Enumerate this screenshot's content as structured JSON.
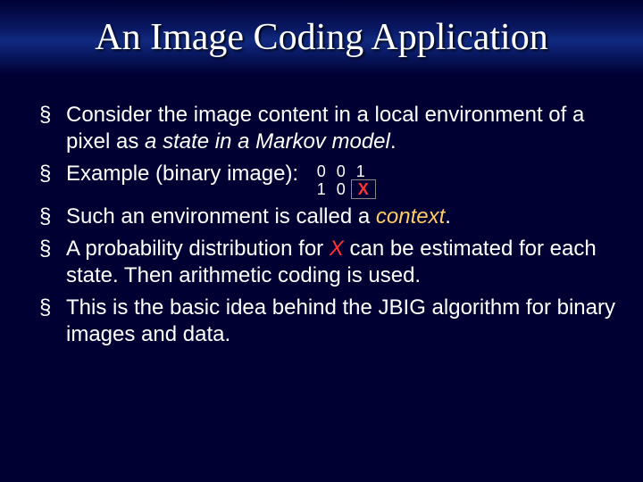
{
  "title": "An Image Coding Application",
  "bullets1": {
    "b1_a": "Consider the image content in a local environment of a pixel as ",
    "b1_b": "a state in a Markov model",
    "b1_c": ".",
    "b2_a": "Example (binary image):"
  },
  "grid": {
    "r0c0": "0",
    "r0c1": "0",
    "r0c2": "1",
    "r1c0": "1",
    "r1c1": "0",
    "r1c2": "X"
  },
  "bullets2": {
    "b3_a": "Such an environment is called a ",
    "b3_b": "context",
    "b3_c": ".",
    "b4_a": "A probability distribution for ",
    "b4_b": "X",
    "b4_c": " can be estimated for each state. Then arithmetic coding is used.",
    "b5": "This is the basic idea behind the JBIG algorithm for binary images and data."
  }
}
